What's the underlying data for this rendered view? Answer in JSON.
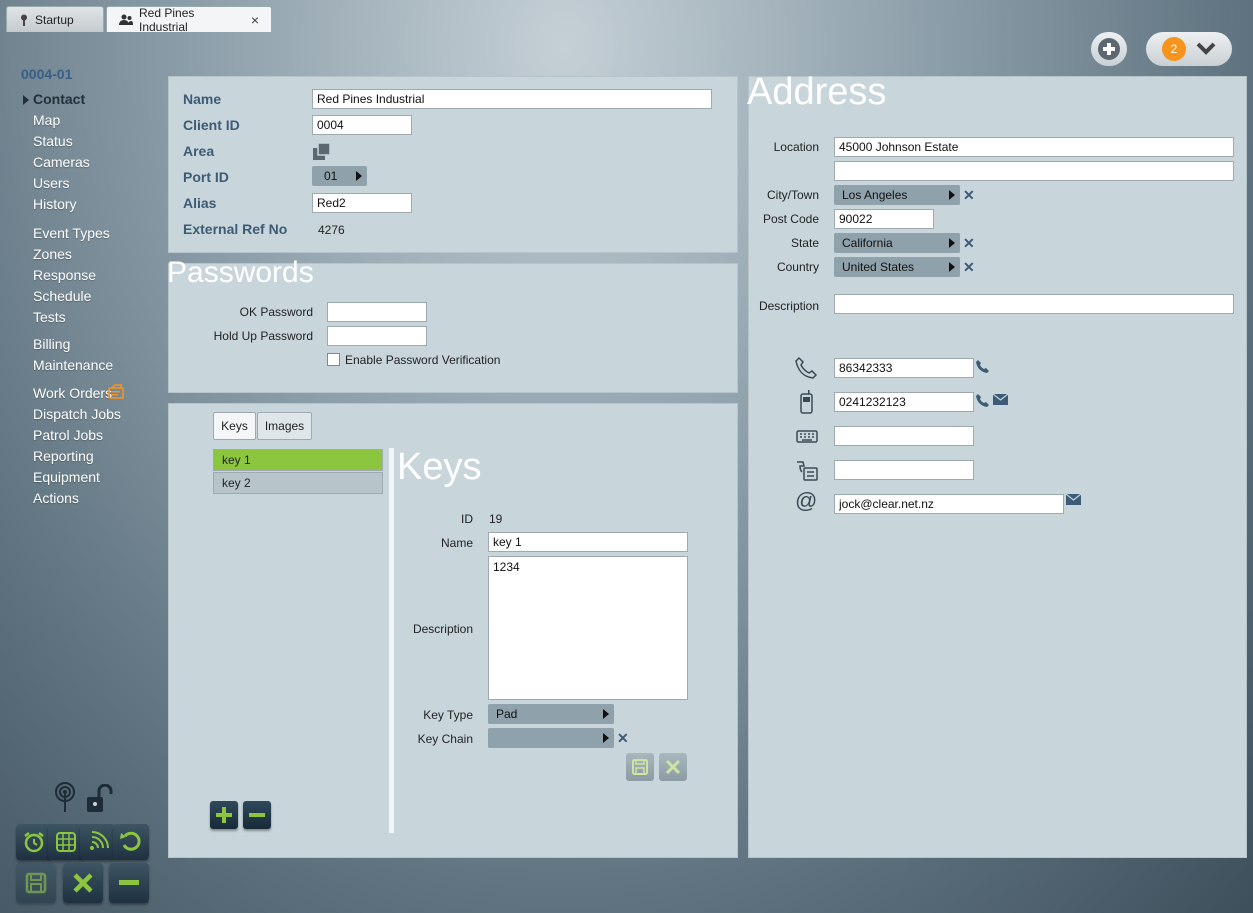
{
  "tabs": [
    {
      "label": "Startup",
      "icon": "key-icon"
    },
    {
      "label": "Red Pines Industrial",
      "icon": "users-icon",
      "close": "×"
    }
  ],
  "header": {
    "notification_count": "2"
  },
  "sidebar": {
    "account_code": "0004-01",
    "items": [
      {
        "label": "Contact"
      },
      {
        "label": "Map"
      },
      {
        "label": "Status"
      },
      {
        "label": "Cameras"
      },
      {
        "label": "Users"
      },
      {
        "label": "History"
      },
      {
        "label": "Event Types"
      },
      {
        "label": "Zones"
      },
      {
        "label": "Response"
      },
      {
        "label": "Schedule"
      },
      {
        "label": "Tests"
      },
      {
        "label": "Billing"
      },
      {
        "label": "Maintenance"
      },
      {
        "label": "Work Orders"
      },
      {
        "label": "Dispatch Jobs"
      },
      {
        "label": "Patrol Jobs"
      },
      {
        "label": "Reporting"
      },
      {
        "label": "Equipment"
      },
      {
        "label": "Actions"
      }
    ]
  },
  "details": {
    "name_label": "Name",
    "name_value": "Red Pines Industrial",
    "client_id_label": "Client ID",
    "client_id_value": "0004",
    "area_label": "Area",
    "port_id_label": "Port ID",
    "port_id_value": "01",
    "alias_label": "Alias",
    "alias_value": "Red2",
    "external_ref_label": "External Ref No",
    "external_ref_value": "4276"
  },
  "passwords": {
    "title": "Passwords",
    "ok_label": "OK Password",
    "ok_value": "",
    "holdup_label": "Hold Up Password",
    "holdup_value": "",
    "verify_label": "Enable Password Verification",
    "verify_checked": false
  },
  "keys_panel": {
    "tabs": [
      "Keys",
      "Images"
    ],
    "list": [
      "key 1",
      "key 2"
    ],
    "title": "Keys",
    "id_label": "ID",
    "id_value": "19",
    "name_label": "Name",
    "name_value": "key 1",
    "description_label": "Description",
    "description_value": "1234",
    "key_type_label": "Key Type",
    "key_type_value": "Pad",
    "key_chain_label": "Key Chain",
    "key_chain_value": ""
  },
  "address": {
    "title": "Address",
    "location_label": "Location",
    "location_line1": "45000 Johnson Estate",
    "location_line2": "",
    "city_label": "City/Town",
    "city_value": "Los Angeles",
    "postcode_label": "Post Code",
    "postcode_value": "90022",
    "state_label": "State",
    "state_value": "California",
    "country_label": "Country",
    "country_value": "United States",
    "description_label": "Description",
    "description_value": "",
    "phone": "86342333",
    "mobile": "0241232123",
    "fax": "",
    "other_phone": "",
    "email": "jock@clear.net.nz"
  },
  "colors": {
    "accent_green": "#8cc63f",
    "badge_orange": "#f7941d",
    "label_blue": "#3d5b74",
    "panel_bg": "#c8d6dc"
  }
}
